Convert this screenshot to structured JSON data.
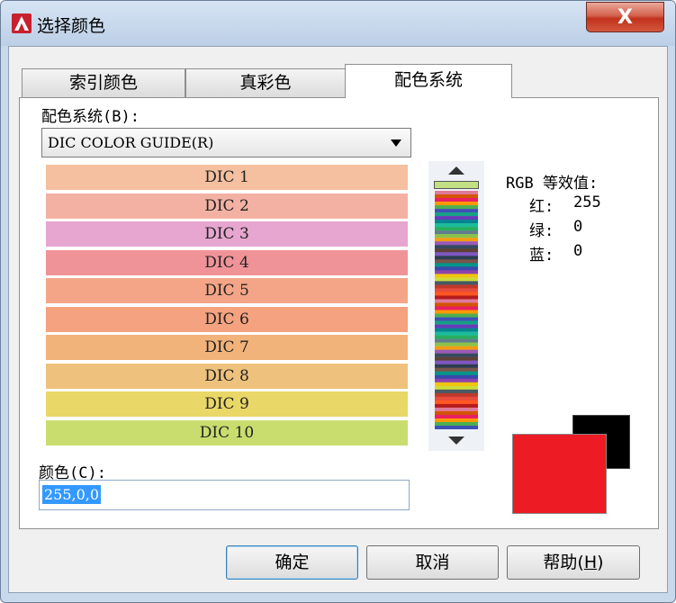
{
  "window": {
    "title": "选择颜色",
    "close_glyph": "X"
  },
  "tabs": [
    {
      "label": "索引颜色",
      "active": false
    },
    {
      "label": "真彩色",
      "active": false
    },
    {
      "label": "配色系统",
      "active": true
    }
  ],
  "color_book": {
    "label": "配色系统(B):",
    "selected": "DIC COLOR GUIDE(R)",
    "swatches": [
      {
        "label": "DIC 1",
        "color": "#f4c09f"
      },
      {
        "label": "DIC 2",
        "color": "#f3b1a3"
      },
      {
        "label": "DIC 3",
        "color": "#e6a6cf"
      },
      {
        "label": "DIC 4",
        "color": "#f09399"
      },
      {
        "label": "DIC 5",
        "color": "#f4a587"
      },
      {
        "label": "DIC 6",
        "color": "#f4a27f"
      },
      {
        "label": "DIC 7",
        "color": "#f2b37b"
      },
      {
        "label": "DIC 8",
        "color": "#eec27c"
      },
      {
        "label": "DIC 9",
        "color": "#e9d767"
      },
      {
        "label": "DIC 10",
        "color": "#c9dd6e"
      }
    ]
  },
  "rgb": {
    "heading": "RGB 等效值:",
    "red_label": "红:",
    "red": "255",
    "green_label": "绿:",
    "green": "0",
    "blue_label": "蓝:",
    "blue": "0"
  },
  "color_field": {
    "label": "颜色(C):",
    "value": "255,0,0"
  },
  "preview": {
    "new_color": "#ed1c24",
    "old_color": "#000000"
  },
  "buttons": {
    "ok": "确定",
    "cancel": "取消",
    "help_prefix": "帮助(",
    "help_key": "H",
    "help_suffix": ")"
  }
}
